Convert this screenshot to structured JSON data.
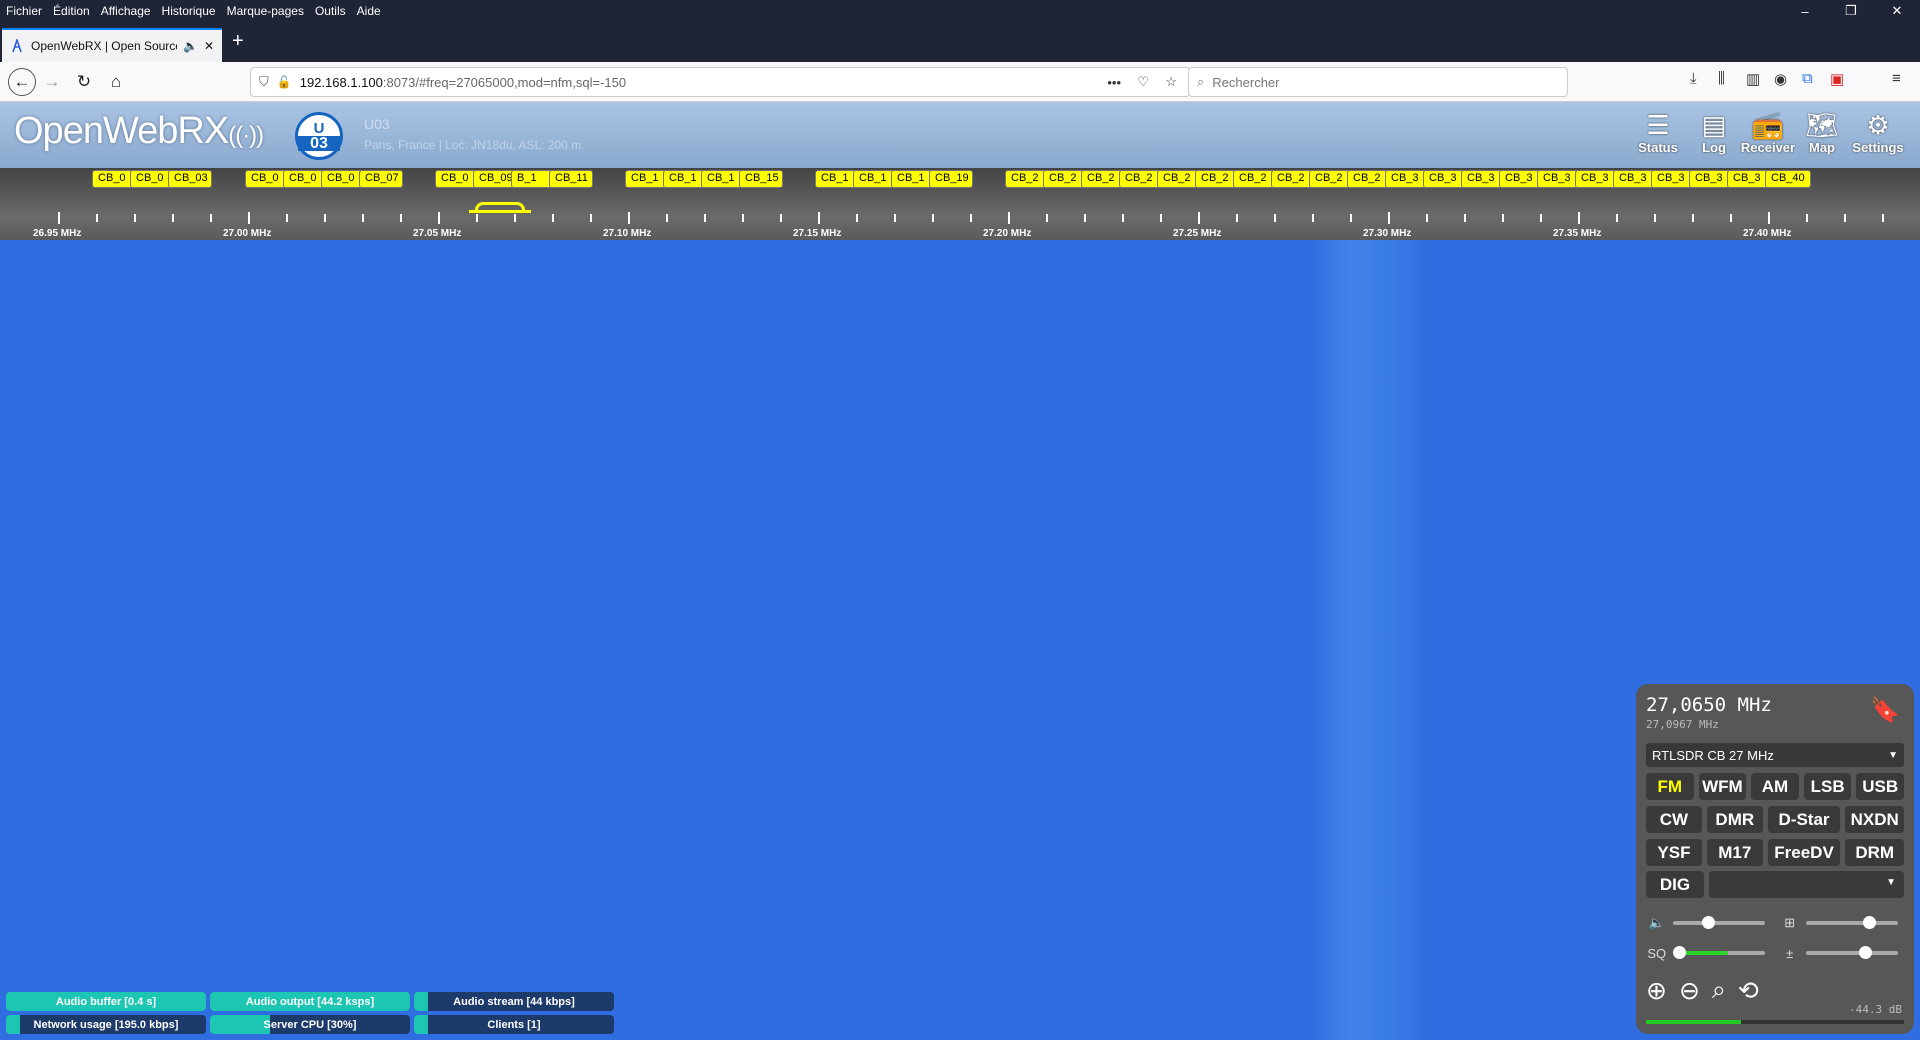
{
  "browser": {
    "menu": [
      "Fichier",
      "Édition",
      "Affichage",
      "Historique",
      "Marque-pages",
      "Outils",
      "Aide"
    ],
    "tab_title": "OpenWebRX | Open Source",
    "url_host": "192.168.1.100",
    "url_rest": ":8073/#freq=27065000,mod=nfm,sql=-150",
    "search_placeholder": "Rechercher"
  },
  "app": {
    "logo_text": "OpenWebRX",
    "badge_top": "U",
    "badge_bottom": "03",
    "receiver_name": "U03",
    "receiver_location": "Paris, France | Loc: JN18du, ASL: 200 m.",
    "nav": [
      {
        "label": "Status",
        "icon": "status-icon"
      },
      {
        "label": "Log",
        "icon": "log-icon"
      },
      {
        "label": "Receiver",
        "icon": "receiver-icon"
      },
      {
        "label": "Map",
        "icon": "map-icon"
      },
      {
        "label": "Settings",
        "icon": "settings-icon"
      }
    ]
  },
  "scale": {
    "labels": [
      "26.95 MHz",
      "27.00 MHz",
      "27.05 MHz",
      "27.10 MHz",
      "27.15 MHz",
      "27.20 MHz",
      "27.25 MHz",
      "27.30 MHz",
      "27.35 MHz",
      "27.40 MHz"
    ],
    "bookmarks": [
      "CB_0",
      "CB_0",
      "CB_03",
      "CB_0",
      "CB_0",
      "CB_0",
      "CB_07",
      "CB_0",
      "CB_09",
      "B_1",
      "CB_11",
      "CB_1",
      "CB_1",
      "CB_1",
      "CB_15",
      "CB_1",
      "CB_1",
      "CB_1",
      "CB_19",
      "CB_2",
      "CB_2",
      "CB_2",
      "CB_2",
      "CB_2",
      "CB_2",
      "CB_2",
      "CB_2",
      "CB_2",
      "CB_2",
      "CB_3",
      "CB_3",
      "CB_3",
      "CB_3",
      "CB_3",
      "CB_3",
      "CB_3",
      "CB_3",
      "CB_3",
      "CB_3",
      "CB_40"
    ]
  },
  "panel": {
    "frequency": "27,0650 MHz",
    "secondary_frequency": "27,0967 MHz",
    "profile": "RTLSDR CB 27 MHz",
    "modes_row1": [
      "FM",
      "WFM",
      "AM",
      "LSB",
      "USB"
    ],
    "modes_row2": [
      "CW",
      "DMR",
      "D-Star",
      "NXDN"
    ],
    "modes_row3": [
      "YSF",
      "M17",
      "FreeDV",
      "DRM"
    ],
    "dig_label": "DIG",
    "volume_level": 0.35,
    "nr_level": 0.7,
    "squelch_level": 0.0,
    "squelch_label": "SQ",
    "gain_level": 0.65,
    "db_value": "-44.3 dB",
    "smeter_level": 0.37,
    "colors": {
      "active_mode": "#ffff00",
      "panel_bg": "#575757"
    }
  },
  "status_bars": [
    {
      "label": "Audio buffer [0.4 s]",
      "fill": 1.0
    },
    {
      "label": "Audio output [44.2 ksps]",
      "fill": 1.0
    },
    {
      "label": "Audio stream [44 kbps]",
      "fill": 0.07
    },
    {
      "label": "Network usage [195.0 kbps]",
      "fill": 0.07
    },
    {
      "label": "Server CPU [30%]",
      "fill": 0.3
    },
    {
      "label": "Clients [1]",
      "fill": 0.07
    }
  ]
}
